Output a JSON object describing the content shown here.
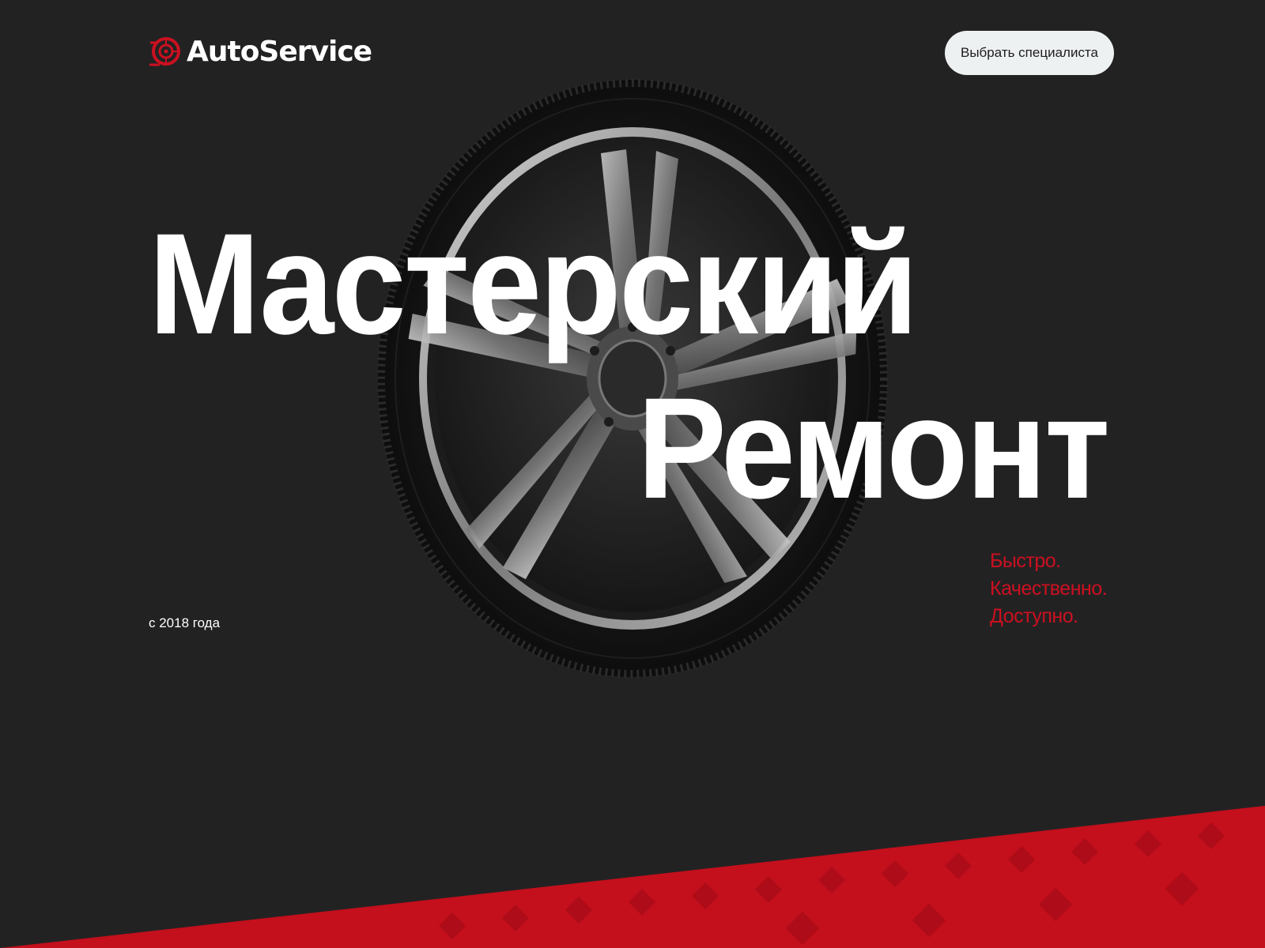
{
  "header": {
    "brand": "AutoService",
    "cta_label": "Выбрать специалиста"
  },
  "hero": {
    "title_line1": "Мастерский",
    "title_line2": "Ремонт",
    "since": "с 2018 года",
    "tagline": [
      "Быстро.",
      "Качественно.",
      "Доступно."
    ]
  },
  "colors": {
    "background": "#232223",
    "accent": "#cc1020",
    "button_bg": "#eef1f2",
    "text": "#ffffff"
  },
  "icons": {
    "logo": "wheel-logo-icon",
    "hero_image": "car-wheel-image"
  }
}
